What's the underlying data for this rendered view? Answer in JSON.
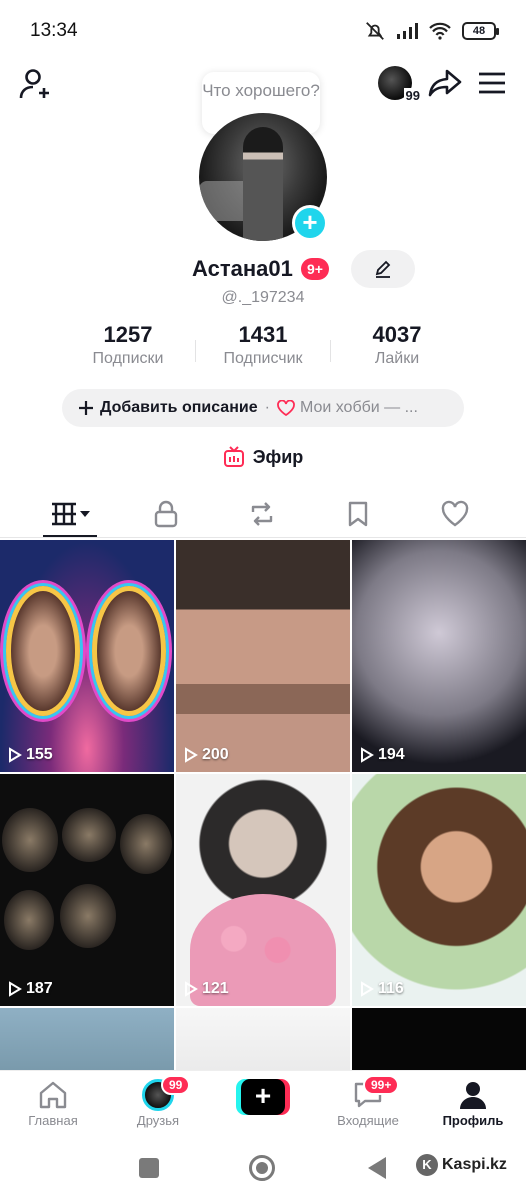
{
  "status_bar": {
    "time": "13:34",
    "battery": "48"
  },
  "header": {
    "question_bubble": "Что хорошего?",
    "mini_avatar_badge": "99"
  },
  "profile": {
    "name": "Астана01",
    "name_badge": "9+",
    "handle": "@._197234",
    "stats": [
      {
        "value": "1257",
        "label": "Подписки"
      },
      {
        "value": "1431",
        "label": "Подписчик"
      },
      {
        "value": "4037",
        "label": "Лайки"
      }
    ],
    "bio_add": "Добавить описание",
    "bio_hobby": "Мои хобби — ...",
    "live_label": "Эфир"
  },
  "videos": [
    {
      "views": "155"
    },
    {
      "views": "200"
    },
    {
      "views": "194"
    },
    {
      "views": "187"
    },
    {
      "views": "121"
    },
    {
      "views": "116"
    },
    {
      "views": ""
    },
    {
      "views": ""
    },
    {
      "views": ""
    }
  ],
  "bottom_nav": {
    "home": "Главная",
    "friends": "Друзья",
    "friends_badge": "99",
    "inbox": "Входящие",
    "inbox_badge": "99+",
    "profile": "Профиль"
  },
  "watermark": "Kaspi.kz",
  "colors": {
    "accent": "#fe2c55",
    "cyan": "#20d5ec",
    "muted": "#8a8b91"
  }
}
